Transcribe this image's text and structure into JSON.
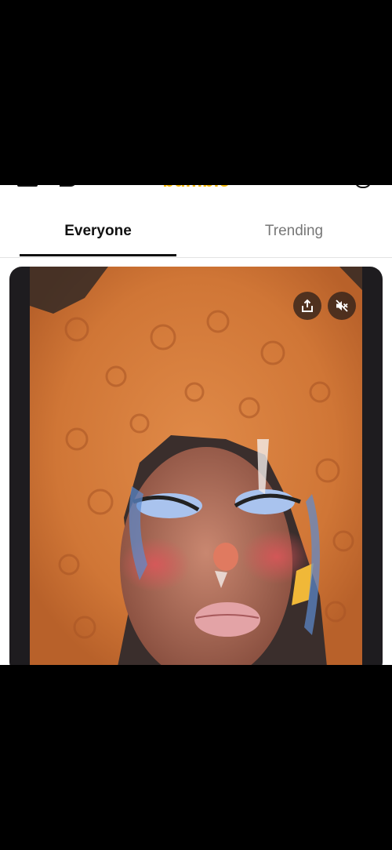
{
  "header": {
    "brand_name": "bumble"
  },
  "tabs": [
    {
      "label": "Everyone",
      "selected": true
    },
    {
      "label": "Trending",
      "selected": false
    }
  ],
  "video": {
    "share_icon": "share-icon",
    "mute_icon": "muted-speaker-icon"
  },
  "colors": {
    "brand": "#f5b800",
    "tab_active": "#111111",
    "tab_inactive": "#777777",
    "hair": "#d97a3a"
  }
}
